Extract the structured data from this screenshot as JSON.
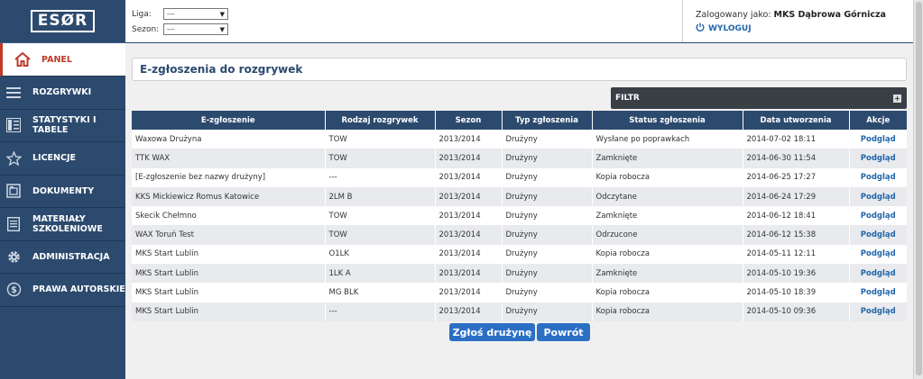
{
  "logo": "ESØR",
  "sidebar": {
    "items": [
      {
        "label": "PANEL",
        "icon": "home-icon"
      },
      {
        "label": "ROZGRYWKI",
        "icon": "menu-icon"
      },
      {
        "label": "STATYSTYKI I TABELE",
        "icon": "stats-icon"
      },
      {
        "label": "LICENCJE",
        "icon": "star-icon"
      },
      {
        "label": "DOKUMENTY",
        "icon": "documents-icon"
      },
      {
        "label": "MATERIAŁY SZKOLENIOWE",
        "icon": "materials-icon"
      },
      {
        "label": "ADMINISTRACJA",
        "icon": "gear-icon"
      },
      {
        "label": "PRAWA AUTORSKIE",
        "icon": "dollar-icon"
      }
    ]
  },
  "filters": {
    "liga_label": "Liga:",
    "liga_value": "---",
    "sezon_label": "Sezon:",
    "sezon_value": "---"
  },
  "user": {
    "logged_prefix": "Zalogowany jako:",
    "logged_name": "MKS Dąbrowa Górnicza",
    "logout": "WYLOGUJ"
  },
  "main": {
    "title": "E-zgłoszenia do rozgrywek",
    "filter_label": "FILTR"
  },
  "table": {
    "headers": [
      "E-zgłoszenie",
      "Rodzaj rozgrywek",
      "Sezon",
      "Typ zgłoszenia",
      "Status zgłoszenia",
      "Data utworzenia",
      "Akcje"
    ],
    "rows": [
      [
        "Waxowa Drużyna",
        "TOW",
        "2013/2014",
        "Drużyny",
        "Wysłane po poprawkach",
        "2014-07-02 18:11",
        "Podgląd"
      ],
      [
        "TTK WAX",
        "TOW",
        "2013/2014",
        "Drużyny",
        "Zamknięte",
        "2014-06-30 11:54",
        "Podgląd"
      ],
      [
        "[E-zgłoszenie bez nazwy drużyny]",
        "---",
        "2013/2014",
        "Drużyny",
        "Kopia robocza",
        "2014-06-25 17:27",
        "Podgląd"
      ],
      [
        "KKS Mickiewicz Romus Katowice",
        "2LM B",
        "2013/2014",
        "Drużyny",
        "Odczytane",
        "2014-06-24 17:29",
        "Podgląd"
      ],
      [
        "Skecik Chełmno",
        "TOW",
        "2013/2014",
        "Drużyny",
        "Zamknięte",
        "2014-06-12 18:41",
        "Podgląd"
      ],
      [
        "WAX Toruń Test",
        "TOW",
        "2013/2014",
        "Drużyny",
        "Odrzucone",
        "2014-06-12 15:38",
        "Podgląd"
      ],
      [
        "MKS Start Lublin",
        "O1LK",
        "2013/2014",
        "Drużyny",
        "Kopia robocza",
        "2014-05-11 12:11",
        "Podgląd"
      ],
      [
        "MKS Start Lublin",
        "1LK A",
        "2013/2014",
        "Drużyny",
        "Zamknięte",
        "2014-05-10 19:36",
        "Podgląd"
      ],
      [
        "MKS Start Lublin",
        "MG BLK",
        "2013/2014",
        "Drużyny",
        "Kopia robocza",
        "2014-05-10 18:39",
        "Podgląd"
      ],
      [
        "MKS Start Lublin",
        "---",
        "2013/2014",
        "Drużyny",
        "Kopia robocza",
        "2014-05-10 09:36",
        "Podgląd"
      ]
    ]
  },
  "buttons": {
    "submit": "Zgłoś drużynę",
    "back": "Powrót"
  },
  "colors": {
    "sidebar": "#2c4a6e",
    "accent": "#c0392b",
    "button": "#2a6fc4",
    "link": "#2266aa"
  }
}
